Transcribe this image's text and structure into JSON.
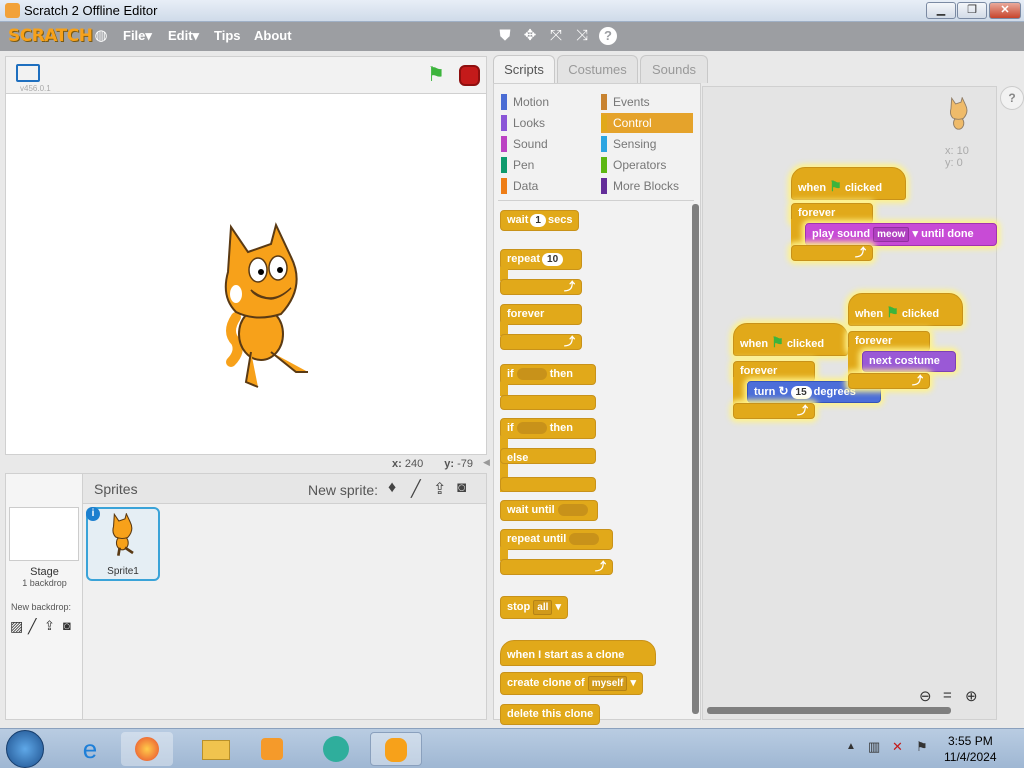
{
  "window": {
    "title": "Scratch 2 Offline Editor",
    "btn_min": "▁",
    "btn_max": "❐",
    "btn_close": "✕"
  },
  "menu": {
    "logo": "SCRATCH",
    "file": "File▾",
    "edit": "Edit▾",
    "tips": "Tips",
    "about": "About"
  },
  "stage": {
    "version": "v456.0.1",
    "x_label": "x:",
    "x_value": "240",
    "y_label": "y:",
    "y_value": "-79"
  },
  "tabs": {
    "scripts": "Scripts",
    "costumes": "Costumes",
    "sounds": "Sounds"
  },
  "categories": {
    "left": [
      "Motion",
      "Looks",
      "Sound",
      "Pen",
      "Data"
    ],
    "right": [
      "Events",
      "Control",
      "Sensing",
      "Operators",
      "More Blocks"
    ],
    "selected": "Control",
    "colors": {
      "Motion": "#4a6cd4",
      "Looks": "#8a55d7",
      "Sound": "#bb42c3",
      "Pen": "#0e9a6c",
      "Data": "#ee7d16",
      "Events": "#c88330",
      "Control": "#e1a91a",
      "Sensing": "#2ca5e2",
      "Operators": "#5cb712",
      "More Blocks": "#632d99"
    }
  },
  "palette": {
    "wait": "wait",
    "wait_val": "1",
    "wait_unit": "secs",
    "repeat": "repeat",
    "repeat_val": "10",
    "forever": "forever",
    "if1": "if",
    "then1": "then",
    "if2": "if",
    "then2": "then",
    "else": "else",
    "wait_until": "wait until",
    "repeat_until": "repeat until",
    "stop": "stop",
    "stop_val": "all",
    "clone_start": "when I start as a clone",
    "create_clone": "create clone of",
    "create_clone_val": "myself",
    "delete_clone": "delete this clone"
  },
  "sprites": {
    "title": "Sprites",
    "new_sprite": "New sprite:",
    "stage_label": "Stage",
    "backdrop_count": "1 backdrop",
    "new_backdrop": "New backdrop:",
    "sprite1": "Sprite1"
  },
  "scripts": {
    "sprite_x": "x: 10",
    "sprite_y": "y: 0",
    "s1": {
      "when": "when",
      "clicked": "clicked",
      "forever": "forever",
      "play": "play sound",
      "sound_val": "meow",
      "until": "until done"
    },
    "s2": {
      "when": "when",
      "clicked": "clicked",
      "forever": "forever",
      "action": "next costume"
    },
    "s3": {
      "when": "when",
      "clicked": "clicked",
      "forever": "forever",
      "turn": "turn",
      "turn_val": "15",
      "degrees": "degrees"
    }
  },
  "taskbar": {
    "time": "3:55 PM",
    "date": "11/4/2024"
  }
}
